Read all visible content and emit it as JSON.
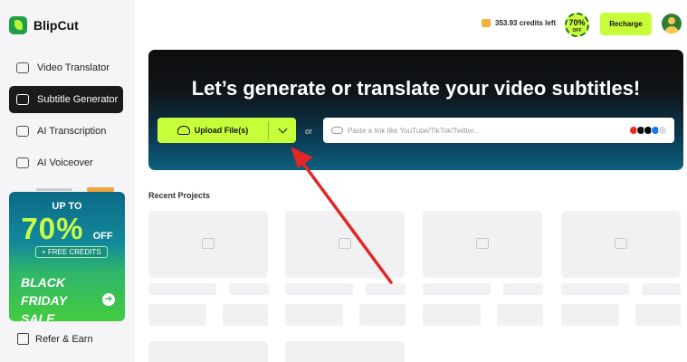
{
  "app": {
    "name": "BlipCut"
  },
  "sidebar": {
    "items": [
      {
        "label": "Video Translator",
        "icon": "video-translate-icon",
        "active": false
      },
      {
        "label": "Subtitle Generator",
        "icon": "subtitle-icon",
        "active": true
      },
      {
        "label": "AI Transcription",
        "icon": "transcription-icon",
        "active": false
      },
      {
        "label": "AI Voiceover",
        "icon": "voiceover-icon",
        "active": false
      }
    ],
    "promo": {
      "up_to": "UP TO",
      "percent": "70%",
      "off": "OFF",
      "free_credits": "+ FREE CREDITS",
      "event_line1": "BLACK FRIDAY",
      "event_line2": "SALE",
      "go": "➔"
    },
    "refer_label": "Refer & Earn"
  },
  "header": {
    "credits_text": "353.93 credits left",
    "off_badge_percent": "70%",
    "off_badge_label": "OFF",
    "recharge_label": "Recharge"
  },
  "hero": {
    "title": "Let’s generate or translate your video subtitles!",
    "upload_label": "Upload File(s)",
    "or_label": "or",
    "link_placeholder": "Paste a link like YouTube/TikTok/Twitter..."
  },
  "platform_icons": [
    "youtube-icon",
    "tiktok-icon",
    "x-icon",
    "facebook-icon",
    "more-icon"
  ],
  "colors": {
    "accent": "#c6ff3a",
    "active_nav": "#1b1b1d",
    "arrow": "#e32626",
    "placeholder_card": "#f1f1f4"
  },
  "recent": {
    "title": "Recent Projects"
  }
}
